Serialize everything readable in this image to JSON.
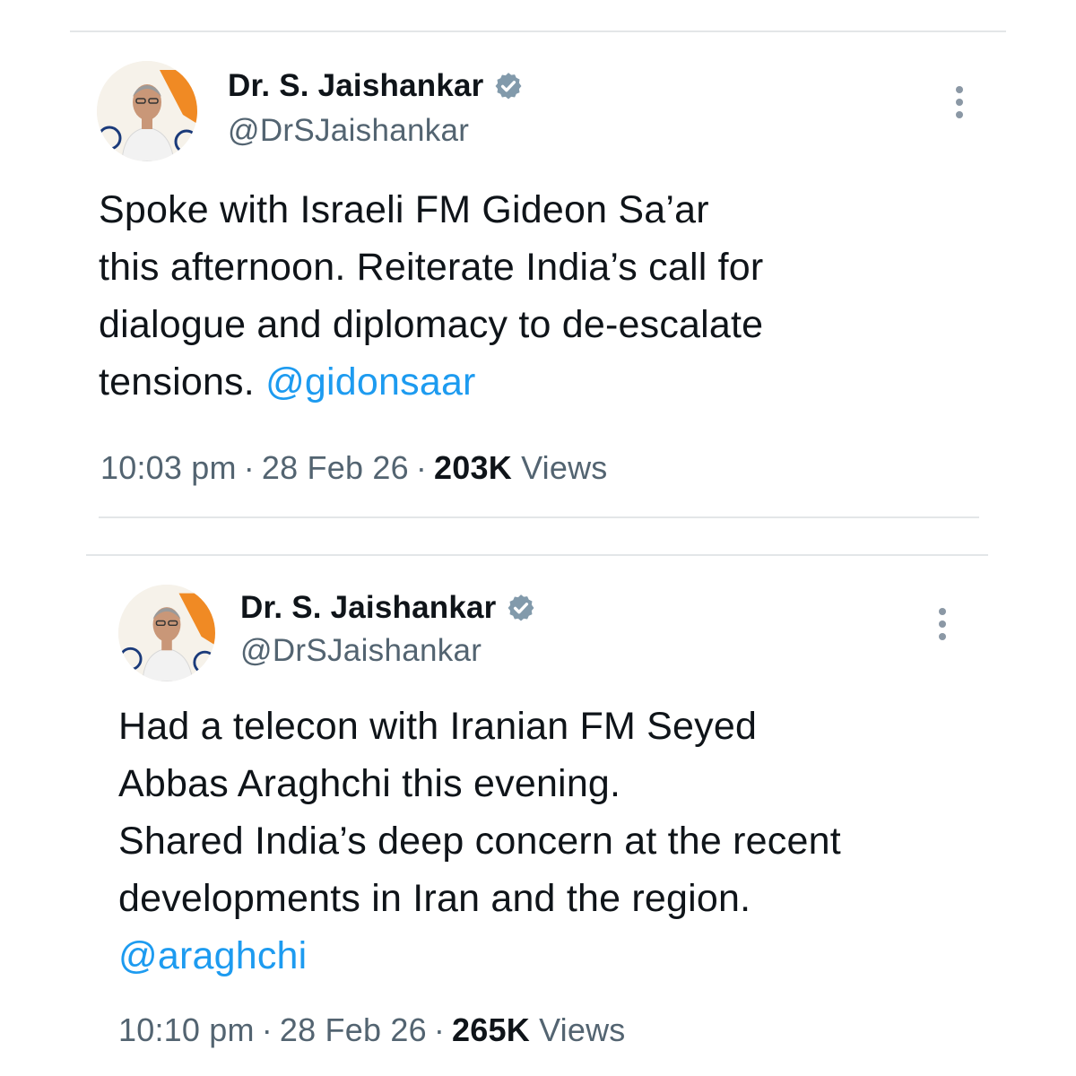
{
  "tweets": [
    {
      "author_name": "Dr. S. Jaishankar",
      "author_handle": "@DrSJaishankar",
      "body_lines": [
        "Spoke with Israeli FM Gideon Sa’ar",
        "this afternoon. Reiterate India’s call for",
        "dialogue and diplomacy to de-escalate",
        "tensions."
      ],
      "mention": "@gidonsaar",
      "time": "10:03 pm",
      "date": "28 Feb 26",
      "views_count": "203K",
      "views_label": "Views",
      "separator": "·"
    },
    {
      "author_name": "Dr. S. Jaishankar",
      "author_handle": "@DrSJaishankar",
      "body_lines": [
        "Had a telecon with Iranian FM Seyed",
        "Abbas Araghchi this evening.",
        "Shared India’s deep concern at the recent",
        "developments in Iran and the region."
      ],
      "mention": "@araghchi",
      "time": "10:10 pm",
      "date": "28 Feb 26",
      "views_count": "265K",
      "views_label": "Views",
      "separator": "·"
    }
  ],
  "colors": {
    "text": "#0f1419",
    "secondary": "#536471",
    "link": "#1d9bf0",
    "verified": "#829aab",
    "divider": "#e3e6e8"
  },
  "icons": {
    "verified": "verified-badge-icon",
    "more": "more-vertical-icon"
  }
}
